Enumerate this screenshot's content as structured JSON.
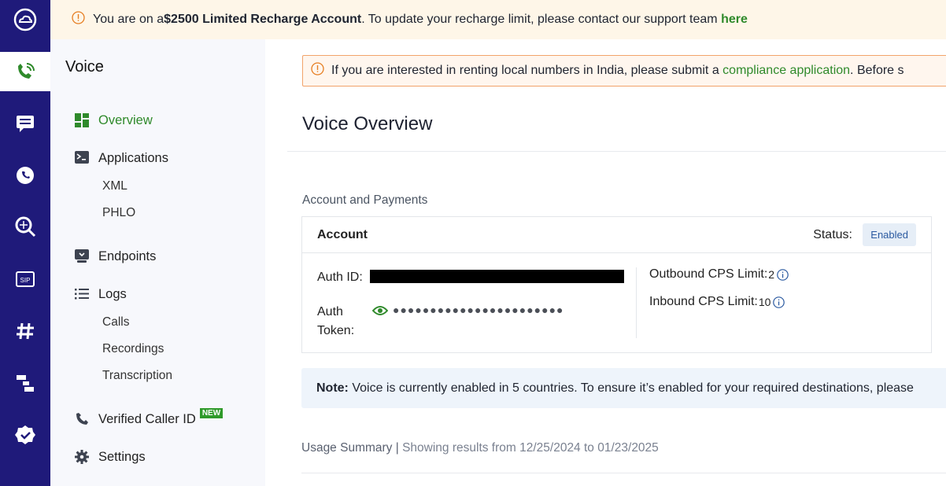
{
  "banner": {
    "prefix": "You are on a ",
    "plan": "$2500 Limited Recharge Account",
    "middle": ". To update your recharge limit, please contact our support team ",
    "link": "here"
  },
  "sidebar": {
    "title": "Voice",
    "items": [
      {
        "label": "Overview",
        "icon": "dashboard-icon"
      },
      {
        "label": "Applications",
        "icon": "terminal-icon"
      },
      {
        "label": "XML"
      },
      {
        "label": "PHLO"
      },
      {
        "label": "Endpoints",
        "icon": "endpoint-icon"
      },
      {
        "label": "Logs",
        "icon": "list-icon"
      },
      {
        "label": "Calls"
      },
      {
        "label": "Recordings"
      },
      {
        "label": "Transcription"
      },
      {
        "label": "Verified Caller ID",
        "icon": "phone-icon",
        "badge": "NEW"
      },
      {
        "label": "Settings",
        "icon": "gear-icon"
      }
    ]
  },
  "notice": {
    "prefix": "If you are interested in renting local numbers in India, please submit a ",
    "link": "compliance application",
    "suffix": ". Before s"
  },
  "page": {
    "title": "Voice Overview",
    "section": "Account and Payments"
  },
  "account": {
    "title": "Account",
    "status_label": "Status:",
    "status": "Enabled",
    "auth_id_label": "Auth ID:",
    "auth_token_label_1": "Auth",
    "auth_token_label_2": "Token:",
    "auth_token_masked": "●●●●●●●●●●●●●●●●●●●●●●●",
    "outbound_label": "Outbound CPS Limit:",
    "outbound_value": "2",
    "inbound_label": "Inbound CPS Limit:",
    "inbound_value": "10"
  },
  "note": {
    "label": "Note:",
    "text": " Voice is currently enabled in 5 countries. To ensure it’s enabled for your required destinations, please"
  },
  "usage": {
    "title": "Usage Summary",
    "sep": " | ",
    "range": "Showing results from 12/25/2024 to 01/23/2025"
  },
  "colors": {
    "rail": "#1f1a7a",
    "accent_green": "#2f8a2b",
    "banner_bg": "#fef6e8",
    "notice_border": "#f2a36a"
  }
}
